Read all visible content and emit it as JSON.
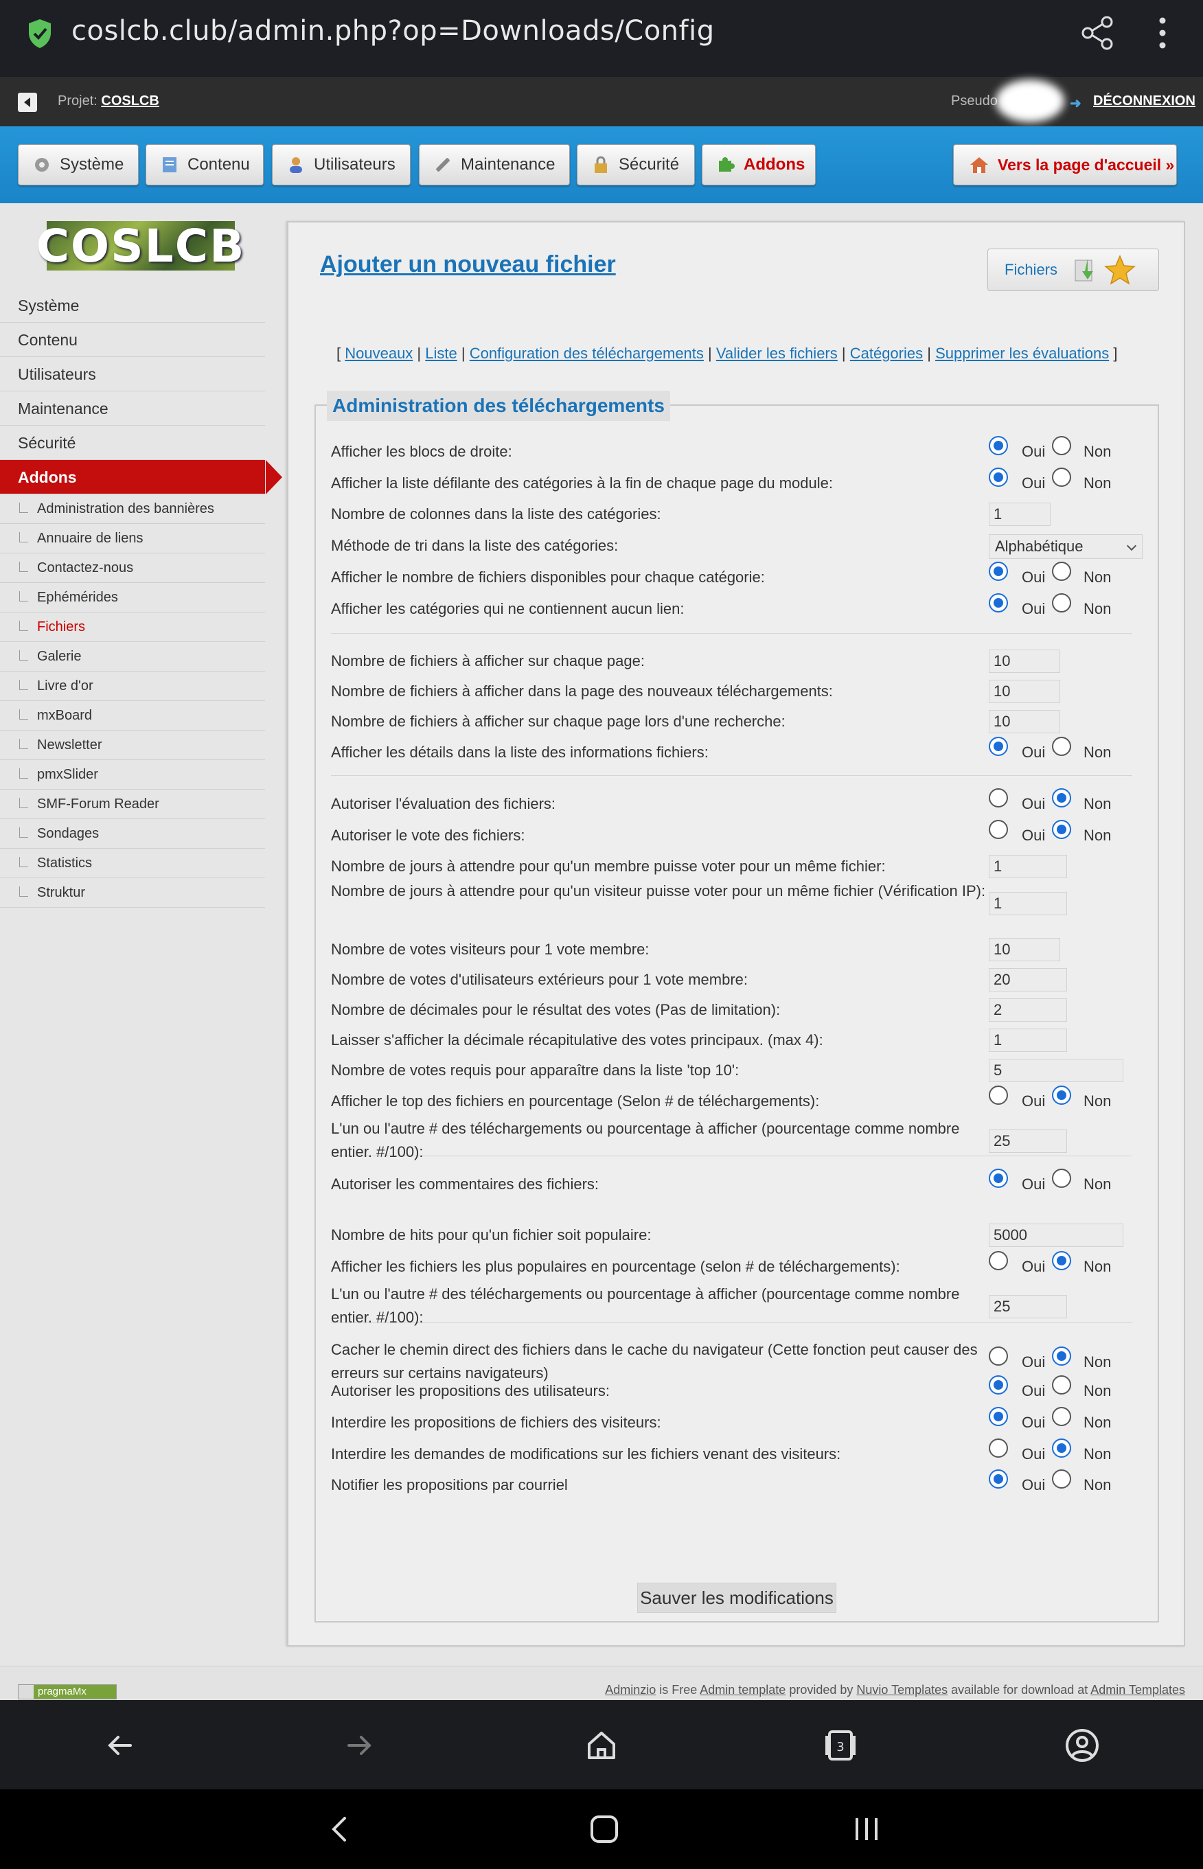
{
  "browser": {
    "url": "coslcb.club/admin.php?op=Downloads/Config"
  },
  "topbar": {
    "projet_label": "Projet:",
    "projet_name": "COSLCB",
    "pseudo_label": "Pseudo",
    "logout": "DÉCONNEXION"
  },
  "nav": {
    "items": [
      {
        "label": "Système"
      },
      {
        "label": "Contenu"
      },
      {
        "label": "Utilisateurs"
      },
      {
        "label": "Maintenance"
      },
      {
        "label": "Sécurité"
      },
      {
        "label": "Addons"
      }
    ],
    "active": "Addons",
    "home": "Vers la page d'accueil »"
  },
  "sidebar": {
    "logo": "COSLCB",
    "main": [
      "Système",
      "Contenu",
      "Utilisateurs",
      "Maintenance",
      "Sécurité",
      "Addons"
    ],
    "sub": [
      "Administration des bannières",
      "Annuaire de liens",
      "Contactez-nous",
      "Ephémérides",
      "Fichiers",
      "Galerie",
      "Livre d'or",
      "mxBoard",
      "Newsletter",
      "pmxSlider",
      "SMF-Forum Reader",
      "Sondages",
      "Statistics",
      "Struktur"
    ],
    "active_sub": "Fichiers"
  },
  "main": {
    "title": "Ajouter un nouveau fichier",
    "badge": "Fichiers",
    "links": [
      "Nouveaux",
      "Liste",
      "Configuration des téléchargements",
      "Valider les fichiers",
      "Catégories",
      "Supprimer les évaluations"
    ],
    "legend": "Administration des téléchargements",
    "oui": "Oui",
    "non": "Non",
    "save": "Sauver les modifications",
    "rows": [
      {
        "label": "Afficher les blocs de droite:",
        "type": "radio",
        "value": "Oui"
      },
      {
        "label": "Afficher la liste défilante des catégories à la fin de chaque page du module:",
        "type": "radio",
        "value": "Oui"
      },
      {
        "label": "Nombre de colonnes dans la liste des catégories:",
        "type": "text",
        "value": "1"
      },
      {
        "label": "Méthode de tri dans la liste des catégories:",
        "type": "select",
        "value": "Alphabétique"
      },
      {
        "label": "Afficher le nombre de fichiers disponibles pour chaque catégorie:",
        "type": "radio",
        "value": "Oui"
      },
      {
        "label": "Afficher les catégories qui ne contiennent aucun lien:",
        "type": "radio",
        "value": "Oui"
      },
      {
        "label": "Nombre de fichiers à afficher sur chaque page:",
        "type": "text",
        "value": "10"
      },
      {
        "label": "Nombre de fichiers à afficher dans la page des nouveaux téléchargements:",
        "type": "text",
        "value": "10"
      },
      {
        "label": "Nombre de fichiers à afficher sur chaque page lors d'une recherche:",
        "type": "text",
        "value": "10"
      },
      {
        "label": "Afficher les détails dans la liste des informations fichiers:",
        "type": "radio",
        "value": "Oui"
      },
      {
        "label": "Autoriser l'évaluation des fichiers:",
        "type": "radio",
        "value": "Non"
      },
      {
        "label": "Autoriser le vote des fichiers:",
        "type": "radio",
        "value": "Non"
      },
      {
        "label": "Nombre de jours à attendre pour qu'un membre puisse voter pour un même fichier:",
        "type": "text",
        "value": "1"
      },
      {
        "label": "Nombre de jours à attendre pour qu'un visiteur puisse voter pour un même fichier (Vérification IP):",
        "type": "text",
        "value": "1"
      },
      {
        "label": "Nombre de votes visiteurs pour 1 vote membre:",
        "type": "text",
        "value": "10"
      },
      {
        "label": "Nombre de votes d'utilisateurs extérieurs pour 1 vote membre:",
        "type": "text",
        "value": "20"
      },
      {
        "label": "Nombre de décimales pour le résultat des votes (Pas de limitation):",
        "type": "text",
        "value": "2"
      },
      {
        "label": "Laisser s'afficher la décimale récapitulative des votes principaux. (max 4):",
        "type": "text",
        "value": "1"
      },
      {
        "label": "Nombre de votes requis pour apparaître dans la liste 'top 10':",
        "type": "text",
        "value": "5"
      },
      {
        "label": "Afficher le top des fichiers en pourcentage (Selon # de téléchargements):",
        "type": "radio",
        "value": "Non"
      },
      {
        "label": "L'un ou l'autre # des téléchargements ou pourcentage à afficher (pourcentage comme nombre entier. #/100):",
        "type": "text",
        "value": "25"
      },
      {
        "label": "Autoriser les commentaires des fichiers:",
        "type": "radio",
        "value": "Oui"
      },
      {
        "label": "Nombre de hits pour qu'un fichier soit populaire:",
        "type": "text",
        "value": "5000"
      },
      {
        "label": "Afficher les fichiers les plus populaires en pourcentage (selon # de téléchargements):",
        "type": "radio",
        "value": "Non"
      },
      {
        "label": "L'un ou l'autre # des téléchargements ou pourcentage à afficher (pourcentage comme nombre entier. #/100):",
        "type": "text",
        "value": "25"
      },
      {
        "label": "Cacher le chemin direct des fichiers dans le cache du navigateur (Cette fonction peut causer des erreurs sur certains navigateurs)",
        "type": "radio",
        "value": "Non"
      },
      {
        "label": "Autoriser les propositions des utilisateurs:",
        "type": "radio",
        "value": "Oui"
      },
      {
        "label": "Interdire les propositions de fichiers des visiteurs:",
        "type": "radio",
        "value": "Oui"
      },
      {
        "label": "Interdire les demandes de modifications sur les fichiers venant des visiteurs:",
        "type": "radio",
        "value": "Non"
      },
      {
        "label": "Notifier les propositions par courriel",
        "type": "radio",
        "value": "Oui"
      }
    ]
  },
  "footer": {
    "pragma": "pragmaMx",
    "credits": [
      {
        "text": "Adminzio",
        "link": true
      },
      {
        "text": " is Free ",
        "link": false
      },
      {
        "text": "Admin template",
        "link": true
      },
      {
        "text": " provided by ",
        "link": false
      },
      {
        "text": "Nuvio Templates",
        "link": true
      },
      {
        "text": " available for download at ",
        "link": false
      },
      {
        "text": "Admin Templates",
        "link": true
      }
    ]
  },
  "colors": {
    "brand_blue": "#1a84c8",
    "active_red": "#c40d0d",
    "link_blue": "#1a73b7"
  }
}
